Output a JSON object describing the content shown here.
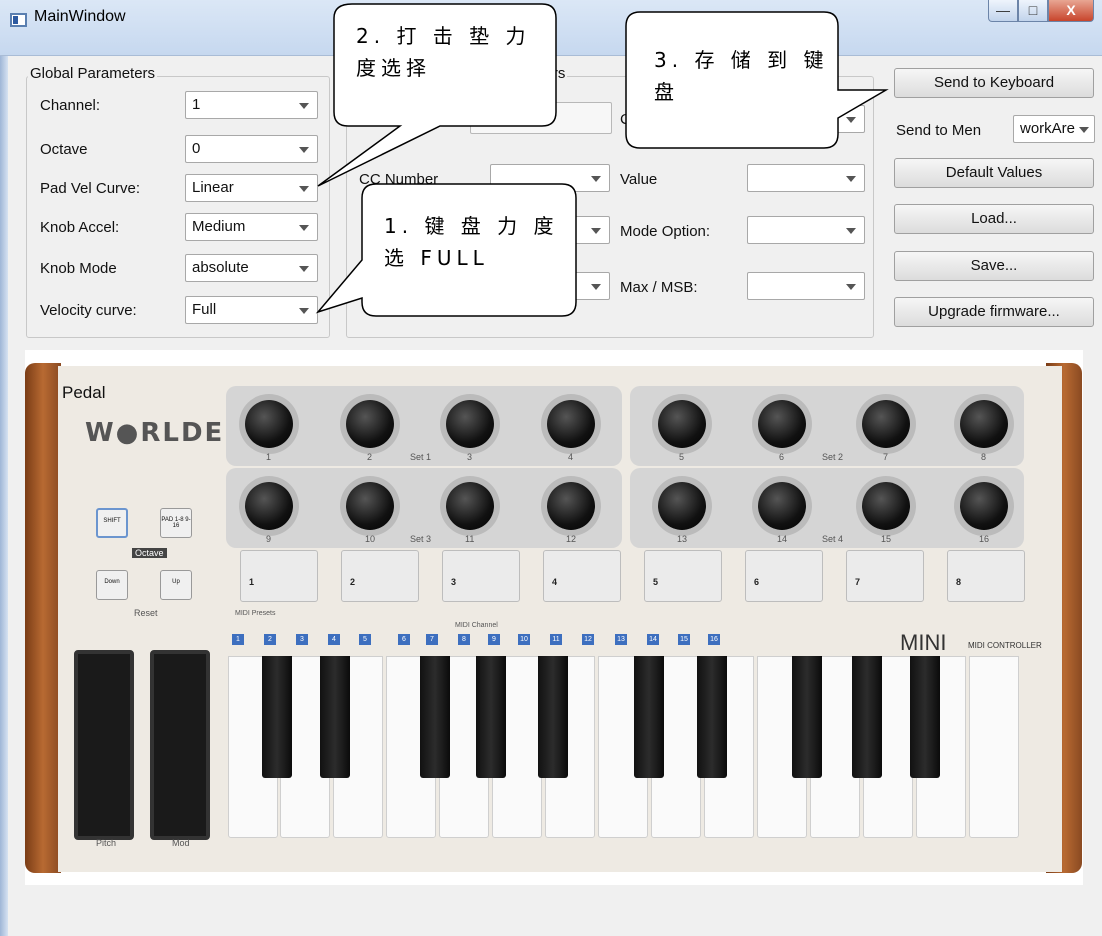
{
  "window": {
    "title": "MainWindow",
    "controls": {
      "minimize": "—",
      "maximize": "□",
      "close": "X"
    }
  },
  "global_params": {
    "title": "Global Parameters",
    "rows": [
      {
        "label": "Channel:",
        "value": "1"
      },
      {
        "label": "Octave",
        "value": "0"
      },
      {
        "label": "Pad Vel Curve:",
        "value": "Linear"
      },
      {
        "label": "Knob Accel:",
        "value": "Medium"
      },
      {
        "label": "Knob Mode",
        "value": "absolute"
      },
      {
        "label": "Velocity curve:",
        "value": "Full"
      }
    ]
  },
  "control_params": {
    "title_fragment": "eters",
    "top_label_fragment": "C",
    "cc_number_label": "CC Number",
    "value_label": "Value",
    "mode_option_label": "Mode Option:",
    "max_msb_label": "Max / MSB:"
  },
  "actions": {
    "send_to_keyboard": "Send to Keyboard",
    "send_to_mem_label": "Send to Men",
    "send_to_mem_value": "workAre",
    "default_values": "Default Values",
    "load": "Load...",
    "save": "Save...",
    "upgrade_firmware": "Upgrade firmware..."
  },
  "callouts": {
    "step2_line1": "2. 打 击 垫 力",
    "step2_line2": "度选择",
    "step3_line1": "3. 存 储 到 键",
    "step3_line2": "盘",
    "step1_line1": "1. 键 盘 力 度",
    "step1_line2": "选 FULL"
  },
  "keyboard": {
    "pedal_label": "Pedal",
    "brand": "W●RLDE",
    "shift_label": "SHIFT",
    "pad_bank_label": "PAD 1-8 9-16",
    "octave_label": "Octave",
    "down_label": "Down",
    "up_label": "Up",
    "reset_label": "Reset",
    "midi_presets_label": "MIDI Presets",
    "midi_channel_label": "MIDI Channel",
    "set_labels": [
      "Set 1",
      "Set 2",
      "Set 3",
      "Set 4"
    ],
    "knob_numbers": [
      "1",
      "2",
      "3",
      "4",
      "5",
      "6",
      "7",
      "8",
      "9",
      "10",
      "11",
      "12",
      "13",
      "14",
      "15",
      "16"
    ],
    "pads": [
      "1",
      "2",
      "3",
      "4",
      "5",
      "6",
      "7",
      "8"
    ],
    "channels": [
      "1",
      "2",
      "3",
      "4",
      "5",
      "6",
      "7",
      "8",
      "9",
      "10",
      "11",
      "12",
      "13",
      "14",
      "15",
      "16"
    ],
    "model": "MINI",
    "model_sub": "MIDI CONTROLLER",
    "pitch_label": "Pitch",
    "mod_label": "Mod"
  }
}
